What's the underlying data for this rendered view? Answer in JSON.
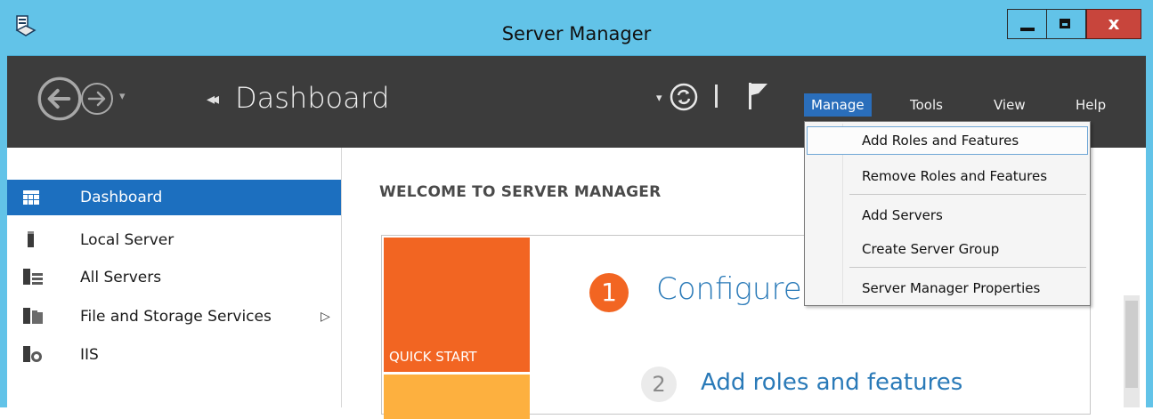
{
  "window": {
    "title": "Server Manager",
    "close_glyph": "x"
  },
  "header": {
    "breadcrumb_chevrons": "◂◂",
    "breadcrumb": "Dashboard",
    "menu": [
      "Manage",
      "Tools",
      "View",
      "Help"
    ],
    "active_menu": "Manage"
  },
  "sidebar": {
    "items": [
      {
        "label": "Dashboard",
        "icon": "dashboard-grid-icon",
        "selected": true
      },
      {
        "label": "Local Server",
        "icon": "server-icon"
      },
      {
        "label": "All Servers",
        "icon": "servers-icon"
      },
      {
        "label": "File and Storage Services",
        "icon": "storage-icon",
        "expand": "▷"
      },
      {
        "label": "IIS",
        "icon": "iis-icon"
      }
    ]
  },
  "main": {
    "welcome_heading": "WELCOME TO SERVER MANAGER",
    "quick_start_label": "QUICK START",
    "step1_number": "1",
    "step1_title": "Configure",
    "step2_number": "2",
    "step2_link": "Add roles and features"
  },
  "manage_menu": {
    "items": [
      "Add Roles and Features",
      "Remove Roles and Features",
      "Add Servers",
      "Create Server Group",
      "Server Manager Properties"
    ]
  },
  "colors": {
    "titlebar": "#62c3e8",
    "commandbar": "#3c3c3c",
    "selection": "#1c6fbf",
    "tile_orange": "#f26522",
    "tile_yellow": "#fdb03f",
    "link": "#2a7ab8"
  }
}
